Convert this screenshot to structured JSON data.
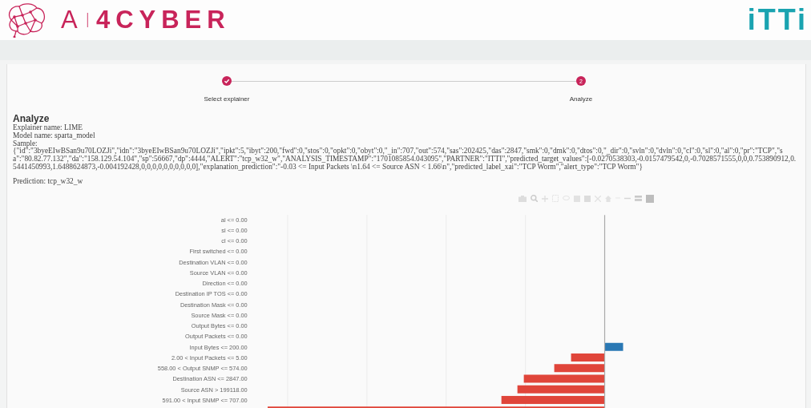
{
  "header": {
    "logo_parts": [
      "A",
      "I",
      "4CYBER"
    ],
    "partner_logo": "iTTi"
  },
  "stepper": [
    {
      "label": "Select explainer",
      "completed": true
    },
    {
      "label": "Analyze",
      "number": "2",
      "completed": false
    }
  ],
  "analyze": {
    "title": "Analyze",
    "explainer": "Explainer name: LIME",
    "model": "Model name: sparta_model",
    "sample_label": "Sample:",
    "sample": "{\"id\":\"3byeEIwBSan9u70LOZJi\",\"idn\":\"3byeEIwBSan9u70LOZJi\",\"ipkt\":5,\"ibyt\":200,\"fwd\":0,\"stos\":0,\"opkt\":0,\"obyt\":0,\"_in\":707,\"out\":574,\"sas\":202425,\"das\":2847,\"smk\":0,\"dmk\":0,\"dtos\":0,\"_dir\":0,\"svln\":0,\"dvln\":0,\"cl\":0,\"sl\":0,\"al\":0,\"pr\":\"TCP\",\"sa\":\"80.82.77.132\",\"da\":\"158.129.54.104\",\"sp\":56667,\"dp\":4444,\"ALERT\":\"tcp_w32_w\",\"ANALYSIS_TIMESTAMP\":\"1701085854.043095\",\"PARTNER\":\"ITTI\",\"predicted_target_values\":[-0.0270538303,-0.0157479542,0,-0.7028571555,0,0,0.753890912,0.5441450993,1.6488624873,-0.004192428,0,0,0,0,0,0,0,0,0,0],\"explanation_prediction\":\"-0.03 <= Input Packets \\n1.64 <= Source ASN < 1.66\\n\",\"predicted_label_xai\":\"TCP Worm\",\"alert_type\":\"TCP Worm\"}",
    "prediction": "Prediction: tcp_w32_w"
  },
  "chart": {
    "labels": [
      "al <= 0.00",
      "sl <= 0.00",
      "cl <= 0.00",
      "First switched <= 0.00",
      "Destination VLAN <= 0.00",
      "Source VLAN <= 0.00",
      "Direction <= 0.00",
      "Destination IP TOS <= 0.00",
      "Destination Mask <= 0.00",
      "Source Mask <= 0.00",
      "Output Bytes <= 0.00",
      "Output Packets <= 0.00",
      "Input Bytes <= 200.00",
      "2.00 < Input Packets <= 5.00",
      "558.00 < Output SNMP <= 574.00",
      "Destination ASN <= 2847.00",
      "Source ASN > 199118.00",
      "591.00 < Input SNMP <= 707.00"
    ]
  }
}
